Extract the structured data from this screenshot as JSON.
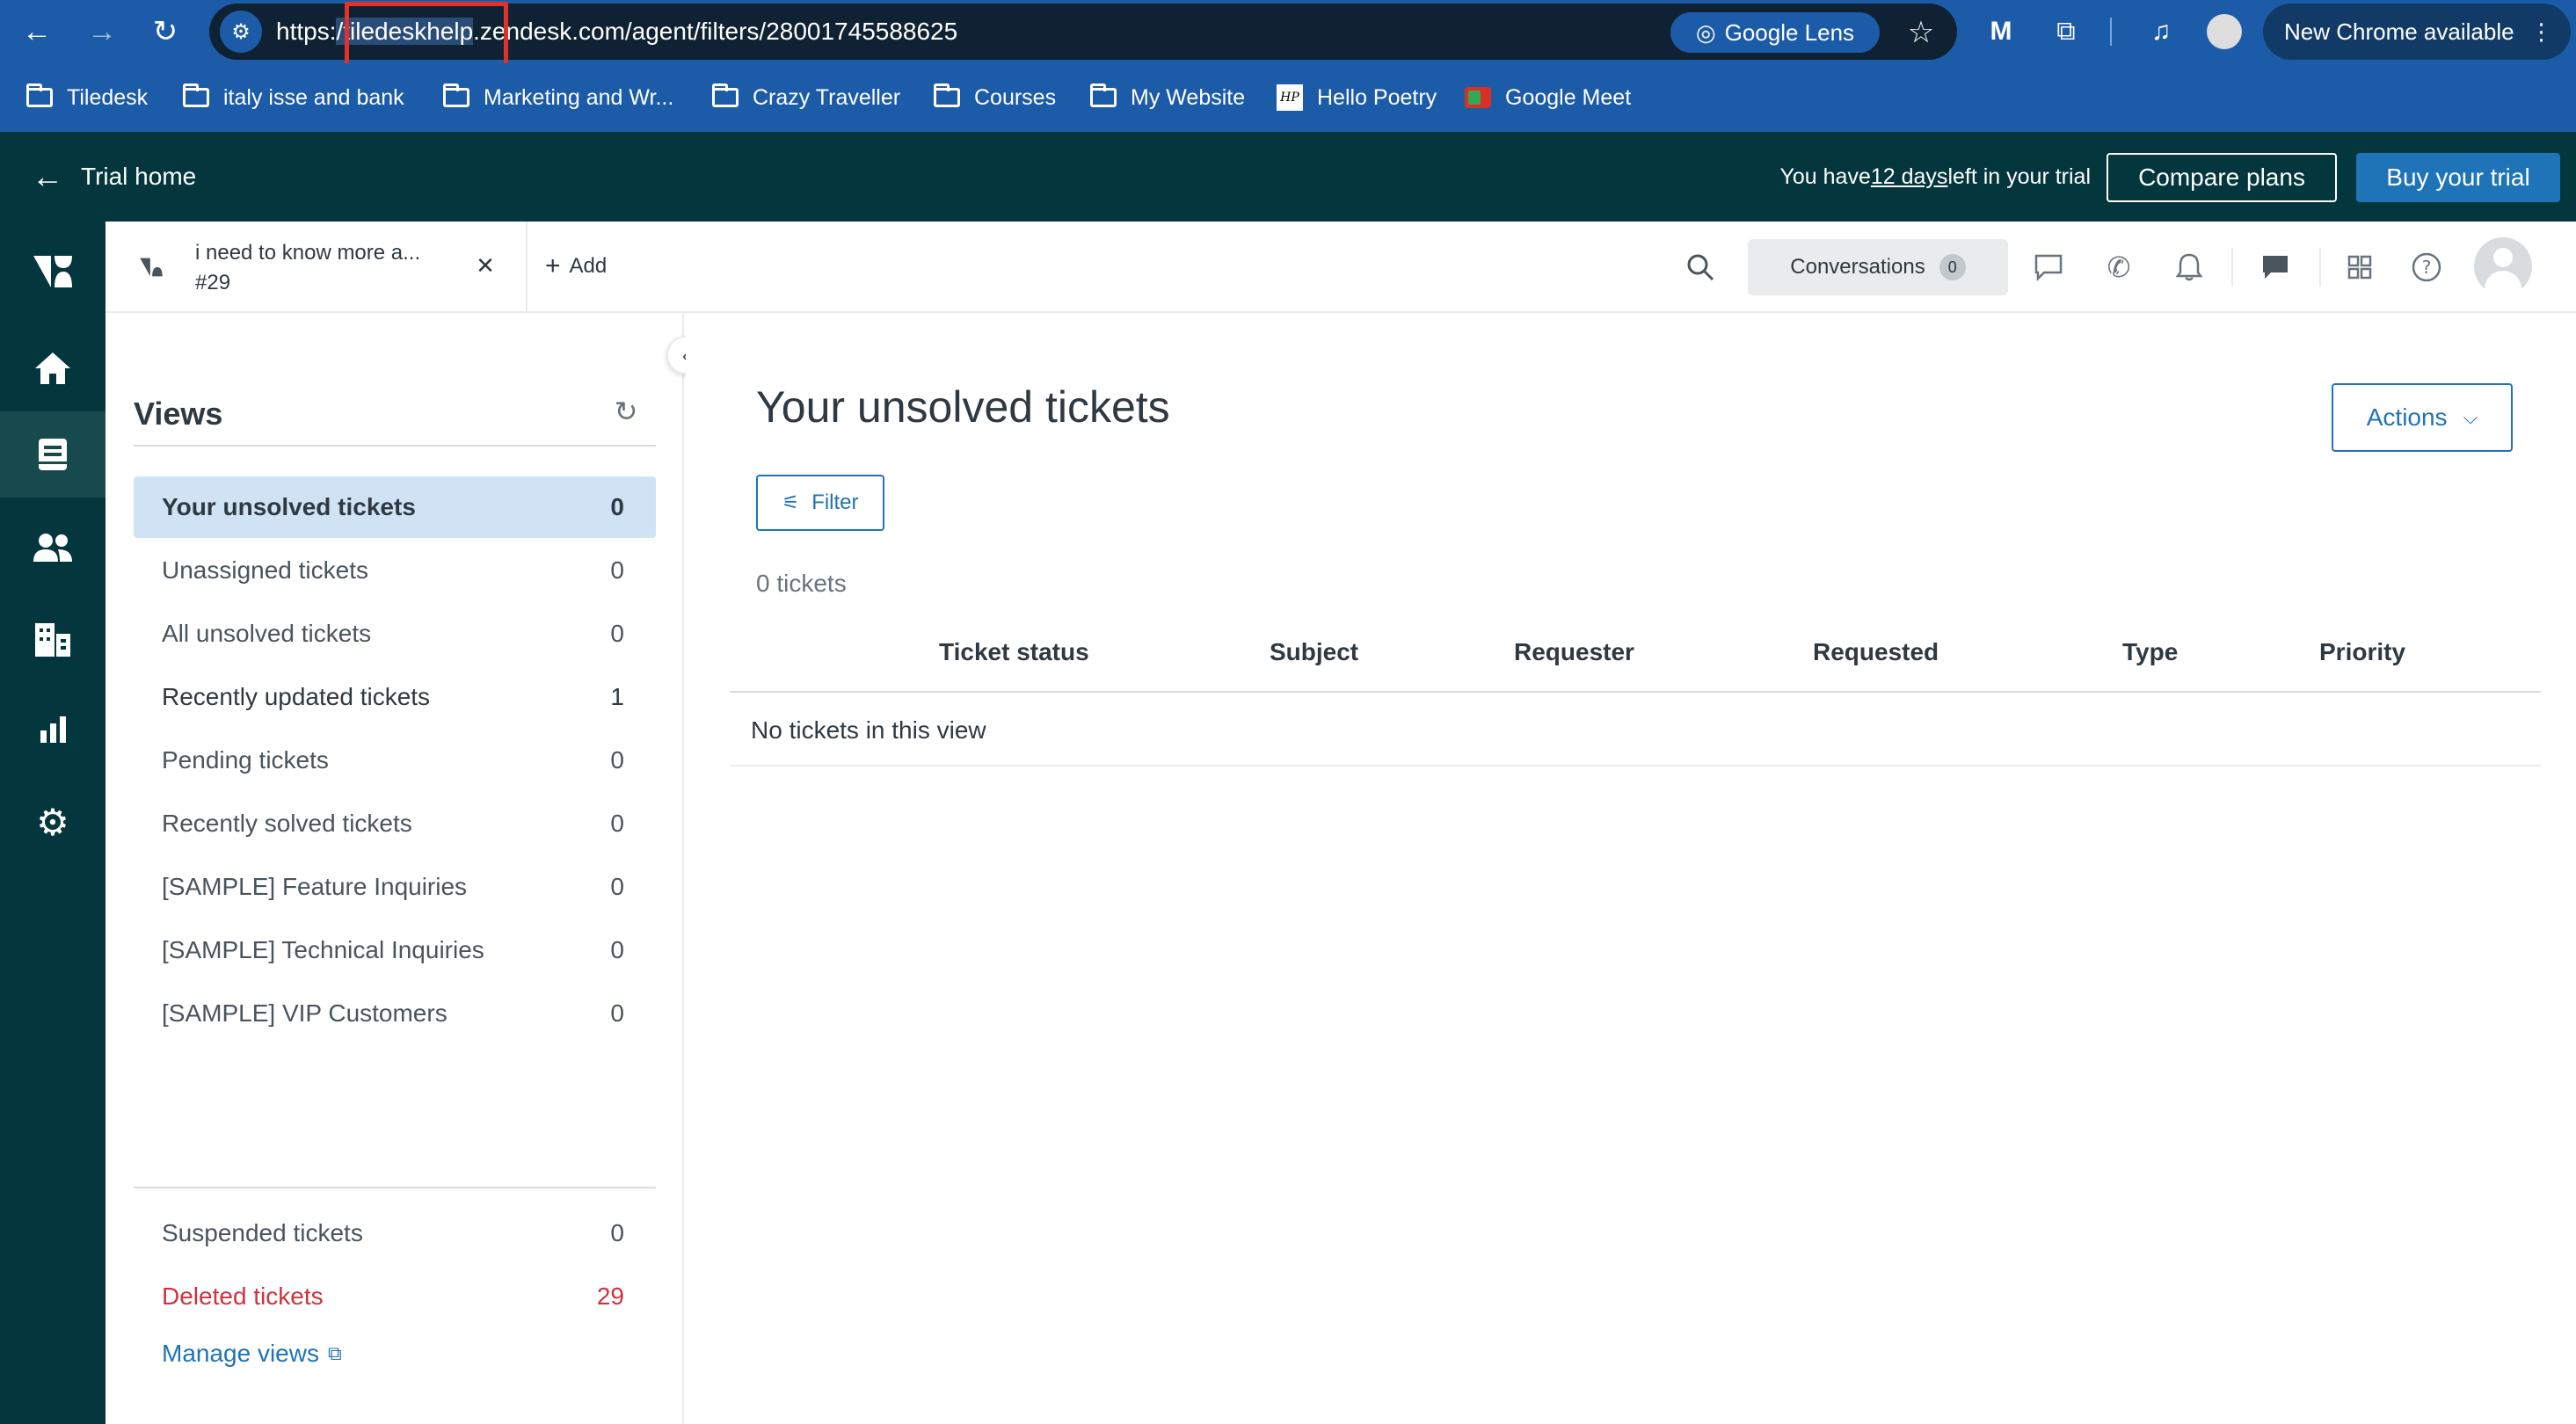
{
  "browser": {
    "url_prefix": "https:",
    "url_highlight": "/tiledeskhelp",
    "url_rest": "zendesk.com/agent/filters/28001745588625",
    "lens_label": "Google Lens",
    "new_chrome_label": "New Chrome available"
  },
  "bookmarks": [
    {
      "label": "Tiledesk",
      "icon": "folder-icon"
    },
    {
      "label": "italy isse and bank",
      "icon": "folder-icon"
    },
    {
      "label": "Marketing and Wr...",
      "icon": "folder-icon"
    },
    {
      "label": "Crazy Traveller",
      "icon": "folder-icon"
    },
    {
      "label": "Courses",
      "icon": "folder-icon"
    },
    {
      "label": "My Website",
      "icon": "folder-icon"
    },
    {
      "label": "Hello Poetry",
      "icon": "hello-poetry-icon"
    },
    {
      "label": "Google Meet",
      "icon": "google-meet-icon"
    }
  ],
  "trial_banner": {
    "home_label": "Trial home",
    "text_before": "You have ",
    "days": "12 days",
    "text_after": " left in your trial",
    "compare_label": "Compare plans",
    "buy_label": "Buy your trial"
  },
  "rail": [
    "zendesk-logo-icon",
    "home-icon",
    "views-icon",
    "customers-icon",
    "organizations-icon",
    "reporting-icon",
    "admin-gear-icon"
  ],
  "header": {
    "tab_title": "i need to know more a...",
    "tab_number": "#29",
    "add_label": "Add",
    "conversations_label": "Conversations",
    "conversations_count": "0"
  },
  "views": {
    "title": "Views",
    "items": [
      {
        "label": "Your unsolved tickets",
        "count": "0"
      },
      {
        "label": "Unassigned tickets",
        "count": "0"
      },
      {
        "label": "All unsolved tickets",
        "count": "0"
      },
      {
        "label": "Recently updated tickets",
        "count": "1"
      },
      {
        "label": "Pending tickets",
        "count": "0"
      },
      {
        "label": "Recently solved tickets",
        "count": "0"
      },
      {
        "label": "[SAMPLE] Feature Inquiries",
        "count": "0"
      },
      {
        "label": "[SAMPLE] Technical Inquiries",
        "count": "0"
      },
      {
        "label": "[SAMPLE] VIP Customers",
        "count": "0"
      }
    ],
    "suspended": {
      "label": "Suspended tickets",
      "count": "0"
    },
    "deleted": {
      "label": "Deleted tickets",
      "count": "29"
    },
    "manage_label": "Manage views"
  },
  "main": {
    "title": "Your unsolved tickets",
    "actions_label": "Actions",
    "filter_label": "Filter",
    "ticket_count": "0 tickets",
    "columns": [
      "Ticket status",
      "Subject",
      "Requester",
      "Requested",
      "Type",
      "Priority"
    ],
    "empty_text": "No tickets in this view"
  },
  "colors": {
    "chrome_blue": "#1c5ba8",
    "zendesk_dark": "#03363d",
    "primary_blue": "#1f73b7",
    "danger_red": "#cc3340",
    "highlight_box": "#e0312b"
  }
}
